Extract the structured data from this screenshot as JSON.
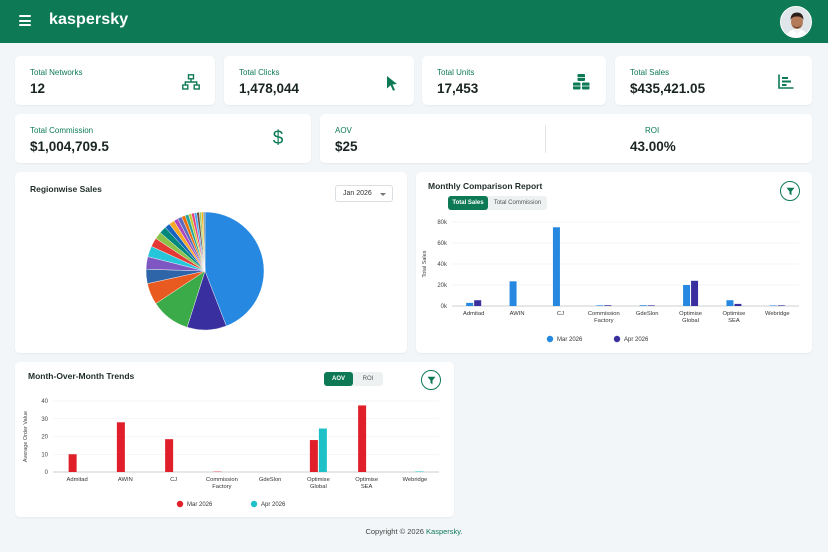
{
  "header": {
    "brand": "kaspersky",
    "menu_icon": "hamburger-icon",
    "avatar_icon": "user-avatar-icon"
  },
  "kpis": [
    {
      "label": "Total Networks",
      "value": "12",
      "icon": "network-icon"
    },
    {
      "label": "Total Clicks",
      "value": "1,478,044",
      "icon": "cursor-icon"
    },
    {
      "label": "Total Units",
      "value": "17,453",
      "icon": "cubes-icon"
    },
    {
      "label": "Total Sales",
      "value": "$435,421.05",
      "icon": "bar-list-icon"
    }
  ],
  "commission": {
    "label": "Total Commission",
    "value": "$1,004,709.5",
    "icon": "dollar-icon"
  },
  "aov": {
    "label": "AOV",
    "value": "$25"
  },
  "roi": {
    "label": "ROI",
    "value": "43.00%"
  },
  "regionwise": {
    "title": "Regionwise Sales",
    "select_value": "Jan 2026",
    "chart_data": {
      "type": "pie",
      "values": [
        45,
        11,
        11,
        6,
        4,
        3.5,
        3,
        2.5,
        2,
        2,
        1.5,
        1.5,
        1.2,
        1.2,
        1,
        1,
        0.8,
        0.8,
        0.7,
        0.7,
        0.6,
        0.5,
        0.5
      ],
      "colors": [
        "#2688e0",
        "#3a2f9e",
        "#3bab49",
        "#e95a21",
        "#2e64a8",
        "#7e57c2",
        "#26c6da",
        "#e53935",
        "#8bc34a",
        "#00897b",
        "#1565c0",
        "#f9a825",
        "#ab47bc",
        "#5c6bc0",
        "#ef6c00",
        "#26a69a",
        "#c0ca33",
        "#ec407a",
        "#42a5f5",
        "#6d4c41",
        "#9ccc65",
        "#ffb300",
        "#78909c"
      ]
    }
  },
  "monthly": {
    "title": "Monthly Comparison Report",
    "tabs": [
      "Total Sales",
      "Total Commission"
    ],
    "active_tab": 0,
    "chart_data": {
      "type": "bar",
      "ylabel": "Total Sales",
      "ylim": [
        0,
        80000
      ],
      "yticks": [
        "0k",
        "20k",
        "40k",
        "60k",
        "80k"
      ],
      "categories": [
        "Admitad",
        "AWIN",
        "CJ",
        "Commission Factory",
        "GdeSlon",
        "Optimise Global",
        "Optimise SEA",
        "Webridge"
      ],
      "category_lines": [
        [
          "Admitad"
        ],
        [
          "AWIN"
        ],
        [
          "CJ"
        ],
        [
          "Commission",
          "Factory"
        ],
        [
          "GdeSlon"
        ],
        [
          "Optimise",
          "Global"
        ],
        [
          "Optimise",
          "SEA"
        ],
        [
          "Webridge"
        ]
      ],
      "series": [
        {
          "name": "Mar 2026",
          "color": "#2688e0",
          "values": [
            3000,
            23500,
            75000,
            600,
            700,
            20000,
            5500,
            500
          ]
        },
        {
          "name": "Apr 2026",
          "color": "#3a2f9e",
          "values": [
            5500,
            0,
            0,
            700,
            600,
            24000,
            2000,
            600
          ]
        }
      ]
    }
  },
  "mom": {
    "title": "Month-Over-Month Trends",
    "tabs": [
      "AOV",
      "ROI"
    ],
    "active_tab": 0,
    "chart_data": {
      "type": "bar",
      "ylabel": "Average Order Value",
      "ylim": [
        0,
        40
      ],
      "yticks": [
        "0",
        "10",
        "20",
        "30",
        "40"
      ],
      "categories": [
        "Admitad",
        "AWIN",
        "CJ",
        "Commission Factory",
        "GdeSlon",
        "Optimise Global",
        "Optimise SEA",
        "Webridge"
      ],
      "category_lines": [
        [
          "Admitad"
        ],
        [
          "AWIN"
        ],
        [
          "CJ"
        ],
        [
          "Commission",
          "Factory"
        ],
        [
          "GdeSlon"
        ],
        [
          "Optimise",
          "Global"
        ],
        [
          "Optimise",
          "SEA"
        ],
        [
          "Webridge"
        ]
      ],
      "series": [
        {
          "name": "Mar 2026",
          "color": "#e01f2a",
          "values": [
            10,
            28,
            18.5,
            0.2,
            0,
            18,
            37.5,
            0
          ]
        },
        {
          "name": "Apr 2026",
          "color": "#1fc1c8",
          "values": [
            0,
            0,
            0,
            0,
            0,
            24.5,
            0,
            0.3
          ]
        }
      ]
    }
  },
  "footer": {
    "text": "Copyright © 2026",
    "brand": "Kaspersky."
  }
}
